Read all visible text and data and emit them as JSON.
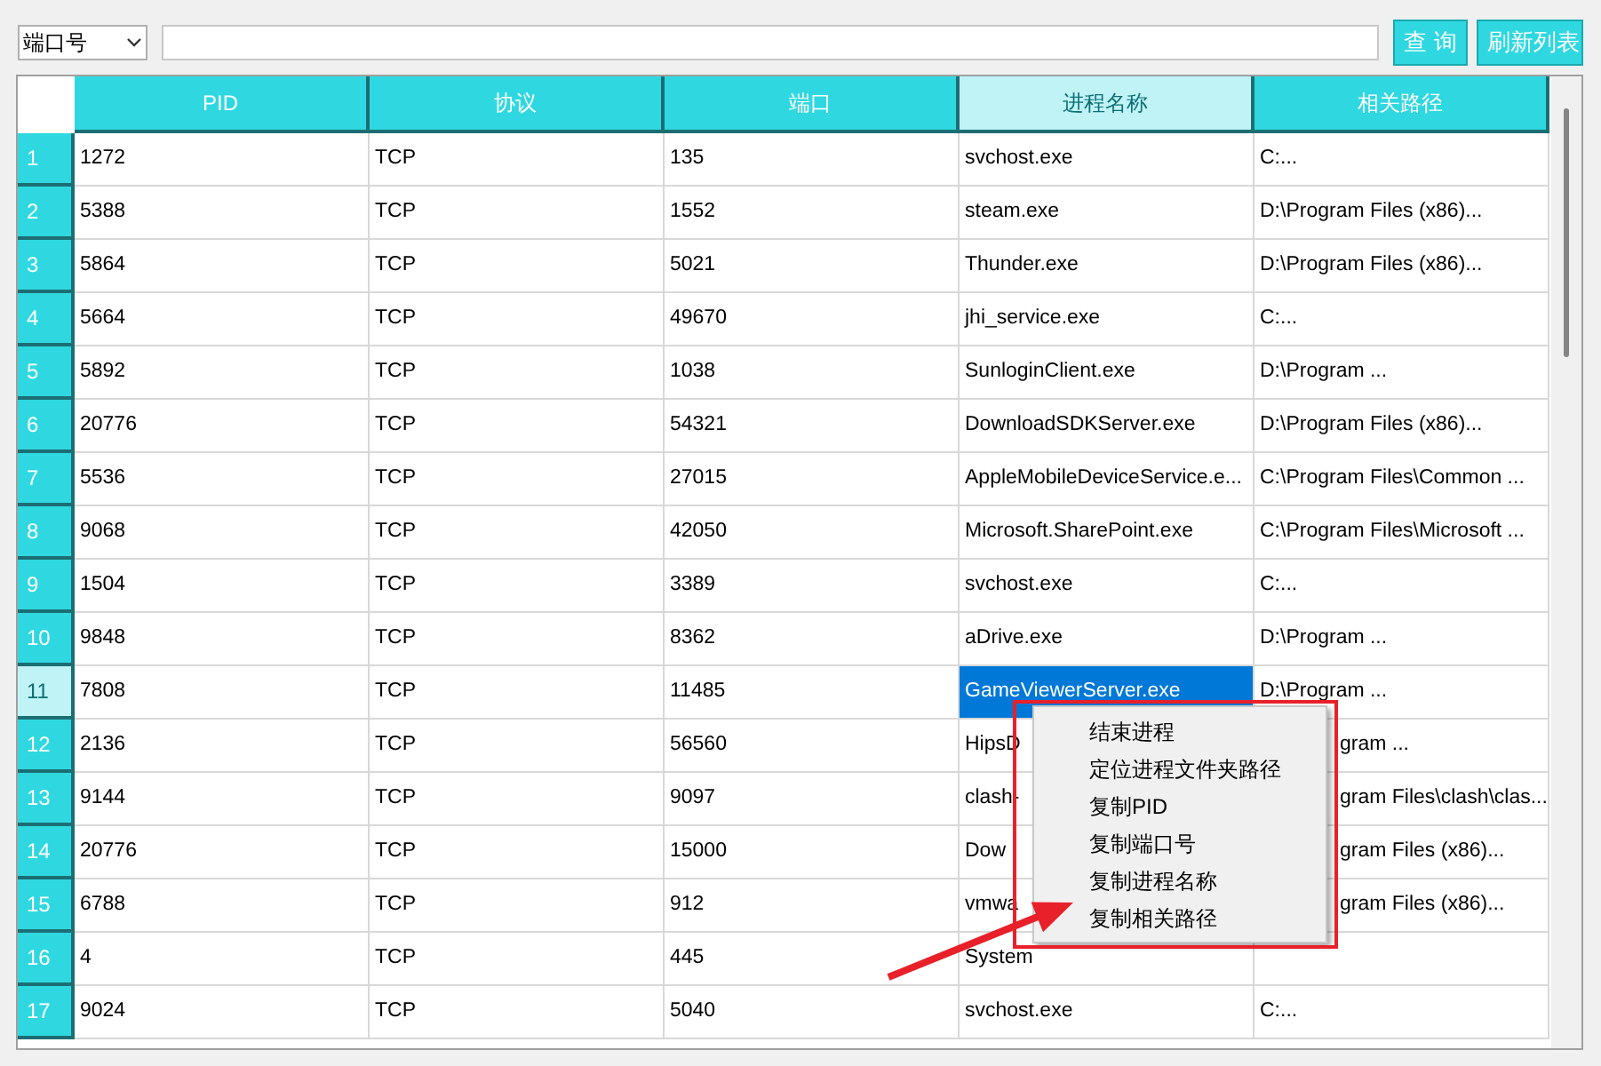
{
  "toolbar": {
    "filter": {
      "value": "端口号"
    },
    "buttons": [
      "查 询",
      "刷新列表"
    ]
  },
  "table": {
    "columns": [
      {
        "label": "PID",
        "selected": false
      },
      {
        "label": "协议",
        "selected": false
      },
      {
        "label": "端口",
        "selected": false
      },
      {
        "label": "进程名称",
        "selected": true
      },
      {
        "label": "相关路径",
        "selected": false
      }
    ],
    "rows": [
      {
        "header": "1",
        "selected": false,
        "cells": [
          "1272",
          "TCP",
          "135",
          "svchost.exe",
          "C:..."
        ]
      },
      {
        "header": "2",
        "selected": false,
        "cells": [
          "5388",
          "TCP",
          "1552",
          "steam.exe",
          "D:\\Program Files (x86)..."
        ]
      },
      {
        "header": "3",
        "selected": false,
        "cells": [
          "5864",
          "TCP",
          "5021",
          "Thunder.exe",
          "D:\\Program Files (x86)..."
        ]
      },
      {
        "header": "4",
        "selected": false,
        "cells": [
          "5664",
          "TCP",
          "49670",
          "jhi_service.exe",
          "C:..."
        ]
      },
      {
        "header": "5",
        "selected": false,
        "cells": [
          "5892",
          "TCP",
          "1038",
          "SunloginClient.exe",
          "D:\\Program ..."
        ]
      },
      {
        "header": "6",
        "selected": false,
        "cells": [
          "20776",
          "TCP",
          "54321",
          "DownloadSDKServer.exe",
          "D:\\Program Files (x86)..."
        ]
      },
      {
        "header": "7",
        "selected": false,
        "cells": [
          "5536",
          "TCP",
          "27015",
          "AppleMobileDeviceService.e...",
          "C:\\Program Files\\Common ..."
        ]
      },
      {
        "header": "8",
        "selected": false,
        "cells": [
          "9068",
          "TCP",
          "42050",
          "Microsoft.SharePoint.exe",
          "C:\\Program Files\\Microsoft ..."
        ]
      },
      {
        "header": "9",
        "selected": false,
        "cells": [
          "1504",
          "TCP",
          "3389",
          "svchost.exe",
          "C:..."
        ]
      },
      {
        "header": "10",
        "selected": false,
        "cells": [
          "9848",
          "TCP",
          "8362",
          "aDrive.exe",
          "D:\\Program ..."
        ]
      },
      {
        "header": "11",
        "selected": true,
        "cells": [
          "7808",
          "TCP",
          "11485",
          "GameViewerServer.exe",
          "D:\\Program ..."
        ]
      },
      {
        "header": "12",
        "selected": false,
        "cells": [
          "2136",
          "TCP",
          "56560",
          "HipsD",
          {
            "text": "gram ...",
            "covered_start": true
          }
        ]
      },
      {
        "header": "13",
        "selected": false,
        "cells": [
          "9144",
          "TCP",
          "9097",
          "clash-",
          {
            "text": "gram Files\\clash\\clas...",
            "covered_start": true
          }
        ]
      },
      {
        "header": "14",
        "selected": false,
        "cells": [
          "20776",
          "TCP",
          "15000",
          "Dow",
          {
            "text": "gram Files (x86)...",
            "covered_start": true
          }
        ]
      },
      {
        "header": "15",
        "selected": false,
        "cells": [
          "6788",
          "TCP",
          "912",
          "vmwa",
          {
            "text": "gram Files (x86)...",
            "covered_start": true
          }
        ]
      },
      {
        "header": "16",
        "selected": false,
        "cells": [
          "4",
          "TCP",
          "445",
          "System",
          ""
        ]
      },
      {
        "header": "17",
        "selected": false,
        "cells": [
          "9024",
          "TCP",
          "5040",
          "svchost.exe",
          "C:..."
        ]
      }
    ]
  },
  "context_menu": {
    "items": [
      "结束进程",
      "定位进程文件夹路径",
      "复制PID",
      "复制端口号",
      "复制进程名称",
      "复制相关路径"
    ]
  }
}
